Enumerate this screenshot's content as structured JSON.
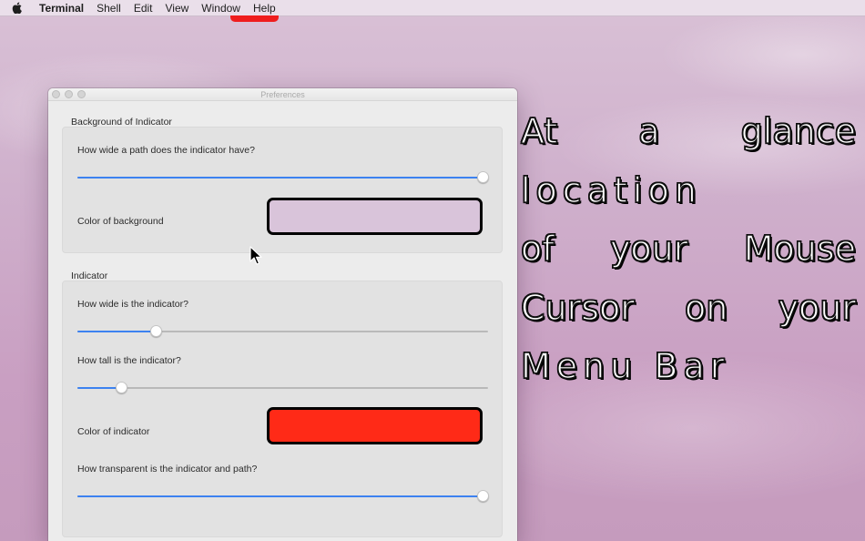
{
  "menubar": {
    "apple_icon": "apple-logo",
    "app_name": "Terminal",
    "items": [
      "Shell",
      "Edit",
      "View",
      "Window",
      "Help"
    ],
    "indicator_color": "#ef1d1d"
  },
  "window": {
    "title": "Preferences",
    "background_section": {
      "title": "Background of Indicator",
      "path_width_label": "How wide a path does the indicator have?",
      "path_width_value": 1.0,
      "color_label": "Color of background",
      "color": "#d9c4da"
    },
    "indicator_section": {
      "title": "Indicator",
      "width_label": "How wide is the indicator?",
      "width_value": 0.19,
      "height_label": "How tall is the indicator?",
      "height_value": 0.107,
      "color_label": "Color of indicator",
      "color": "#ff2a17",
      "transparency_label": "How transparent is the indicator and path?",
      "transparency_value": 1.0
    }
  },
  "caption": {
    "lines": [
      "At a glance",
      "location",
      "of your Mouse",
      "Cursor on your",
      "Menu Bar"
    ]
  }
}
